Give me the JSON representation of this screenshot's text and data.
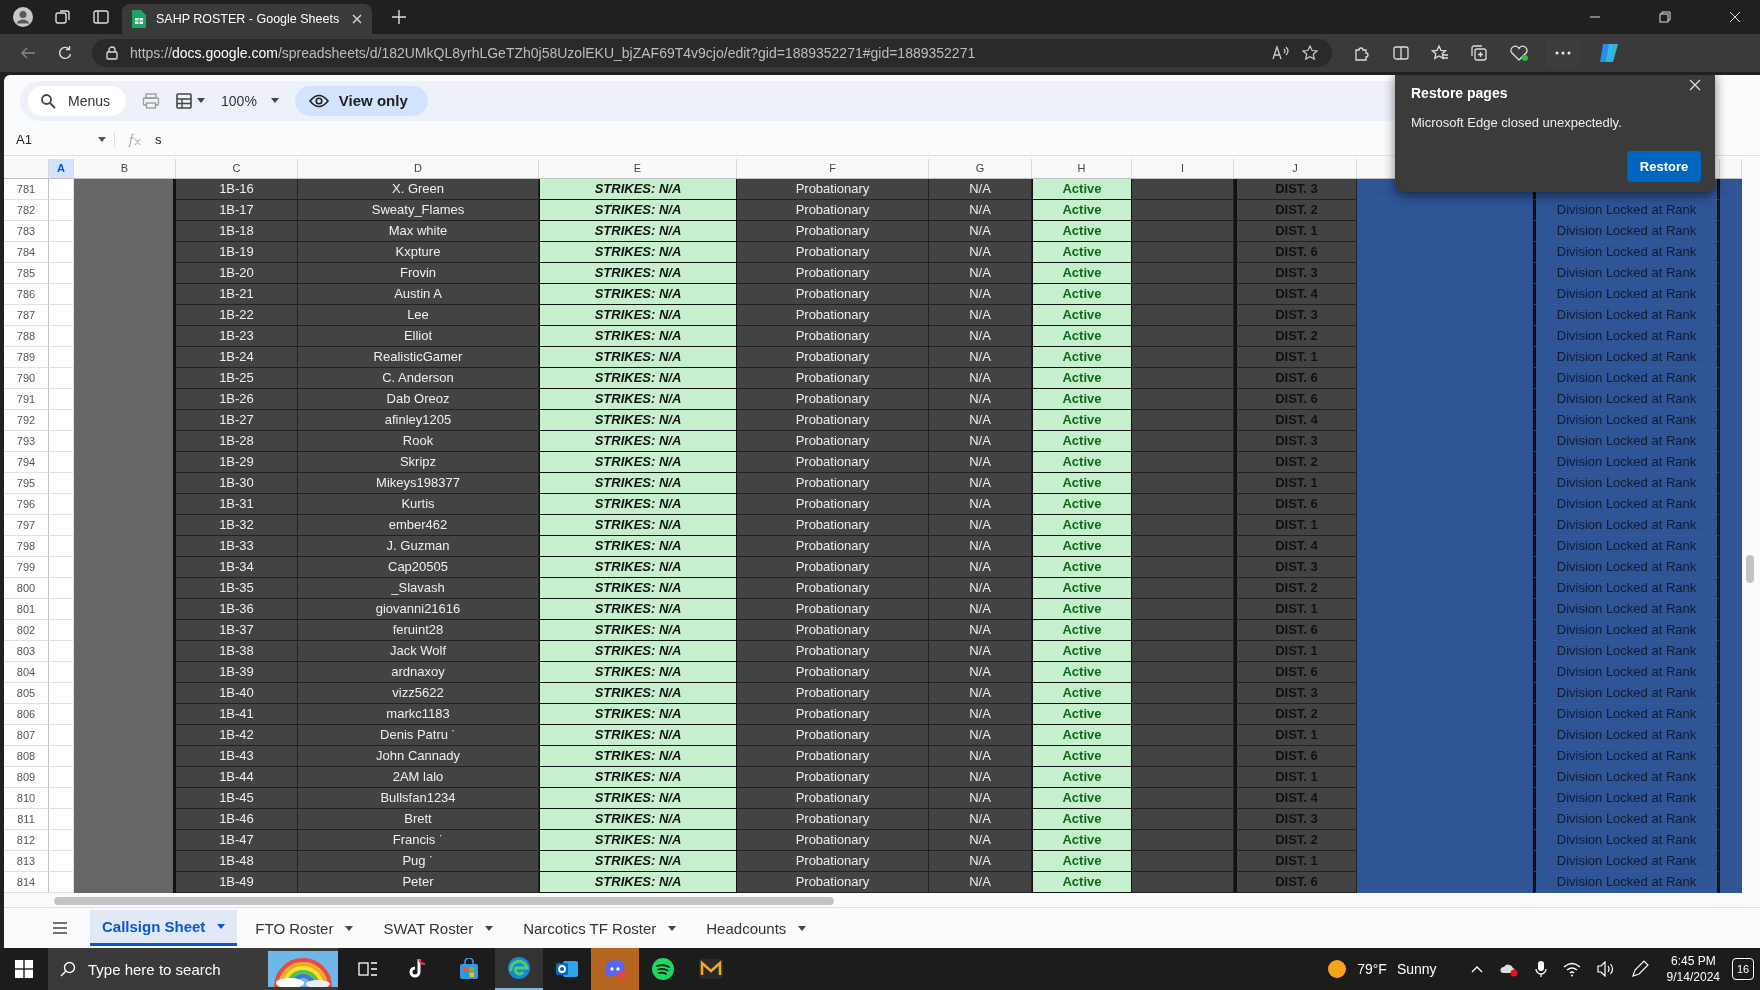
{
  "browser": {
    "tab_title": "SAHP ROSTER - Google Sheets",
    "url": "https://**docs.google.com**/spreadsheets/d/182UMkQL8yrhLGeTZh0j58UzolEKU_bjZAF69T4v9cjo/edit?gid=1889352271#gid=1889352271"
  },
  "toolbar": {
    "search_label": "Menus",
    "zoom": "100%",
    "mode": "View only"
  },
  "formula_bar": {
    "name_box": "A1",
    "formula": "s"
  },
  "columns": [
    {
      "label": "A",
      "selected": true
    },
    {
      "label": "B",
      "selected": false
    },
    {
      "label": "C",
      "selected": false
    },
    {
      "label": "D",
      "selected": false
    },
    {
      "label": "E",
      "selected": false
    },
    {
      "label": "F",
      "selected": false
    },
    {
      "label": "G",
      "selected": false
    },
    {
      "label": "H",
      "selected": false
    },
    {
      "label": "I",
      "selected": false
    },
    {
      "label": "J",
      "selected": false
    }
  ],
  "rows": [
    {
      "number": "781",
      "callsign": "1B-16",
      "name": "X. Green",
      "strikes": "STRIKES: N/A",
      "rank": "Probationary",
      "column_g": "N/A",
      "status": "Active",
      "district": "DIST. 3"
    },
    {
      "number": "782",
      "callsign": "1B-17",
      "name": "Sweaty_Flames",
      "strikes": "STRIKES: N/A",
      "rank": "Probationary",
      "column_g": "N/A",
      "status": "Active",
      "district": "DIST. 2",
      "division": "Division Locked at Rank"
    },
    {
      "number": "783",
      "callsign": "1B-18",
      "name": "Max white",
      "strikes": "STRIKES: N/A",
      "rank": "Probationary",
      "column_g": "N/A",
      "status": "Active",
      "district": "DIST. 1",
      "division": "Division Locked at Rank"
    },
    {
      "number": "784",
      "callsign": "1B-19",
      "name": "Kxpture",
      "strikes": "STRIKES: N/A",
      "rank": "Probationary",
      "column_g": "N/A",
      "status": "Active",
      "district": "DIST. 6",
      "division": "Division Locked at Rank"
    },
    {
      "number": "785",
      "callsign": "1B-20",
      "name": "Frovin",
      "strikes": "STRIKES: N/A",
      "rank": "Probationary",
      "column_g": "N/A",
      "status": "Active",
      "district": "DIST. 3",
      "division": "Division Locked at Rank"
    },
    {
      "number": "786",
      "callsign": "1B-21",
      "name": "Austin A",
      "strikes": "STRIKES: N/A",
      "rank": "Probationary",
      "column_g": "N/A",
      "status": "Active",
      "district": "DIST. 4",
      "division": "Division Locked at Rank"
    },
    {
      "number": "787",
      "callsign": "1B-22",
      "name": "Lee",
      "strikes": "STRIKES: N/A",
      "rank": "Probationary",
      "column_g": "N/A",
      "status": "Active",
      "district": "DIST. 3",
      "division": "Division Locked at Rank"
    },
    {
      "number": "788",
      "callsign": "1B-23",
      "name": "Elliot",
      "strikes": "STRIKES: N/A",
      "rank": "Probationary",
      "column_g": "N/A",
      "status": "Active",
      "district": "DIST. 2",
      "division": "Division Locked at Rank"
    },
    {
      "number": "789",
      "callsign": "1B-24",
      "name": "RealisticGamer",
      "strikes": "STRIKES: N/A",
      "rank": "Probationary",
      "column_g": "N/A",
      "status": "Active",
      "district": "DIST. 1",
      "division": "Division Locked at Rank"
    },
    {
      "number": "790",
      "callsign": "1B-25",
      "name": "C. Anderson",
      "strikes": "STRIKES: N/A",
      "rank": "Probationary",
      "column_g": "N/A",
      "status": "Active",
      "district": "DIST. 6",
      "division": "Division Locked at Rank"
    },
    {
      "number": "791",
      "callsign": "1B-26",
      "name": "Dab Oreoz",
      "strikes": "STRIKES: N/A",
      "rank": "Probationary",
      "column_g": "N/A",
      "status": "Active",
      "district": "DIST. 6",
      "division": "Division Locked at Rank"
    },
    {
      "number": "792",
      "callsign": "1B-27",
      "name": "afinley1205",
      "strikes": "STRIKES: N/A",
      "rank": "Probationary",
      "column_g": "N/A",
      "status": "Active",
      "district": "DIST. 4",
      "division": "Division Locked at Rank"
    },
    {
      "number": "793",
      "callsign": "1B-28",
      "name": "Rook",
      "strikes": "STRIKES: N/A",
      "rank": "Probationary",
      "column_g": "N/A",
      "status": "Active",
      "district": "DIST. 3",
      "division": "Division Locked at Rank"
    },
    {
      "number": "794",
      "callsign": "1B-29",
      "name": "Skripz",
      "strikes": "STRIKES: N/A",
      "rank": "Probationary",
      "column_g": "N/A",
      "status": "Active",
      "district": "DIST. 2",
      "division": "Division Locked at Rank"
    },
    {
      "number": "795",
      "callsign": "1B-30",
      "name": "Mikeys198377",
      "strikes": "STRIKES: N/A",
      "rank": "Probationary",
      "column_g": "N/A",
      "status": "Active",
      "district": "DIST. 1",
      "division": "Division Locked at Rank"
    },
    {
      "number": "796",
      "callsign": "1B-31",
      "name": "Kurtis",
      "strikes": "STRIKES: N/A",
      "rank": "Probationary",
      "column_g": "N/A",
      "status": "Active",
      "district": "DIST. 6",
      "division": "Division Locked at Rank"
    },
    {
      "number": "797",
      "callsign": "1B-32",
      "name": "ember462",
      "strikes": "STRIKES: N/A",
      "rank": "Probationary",
      "column_g": "N/A",
      "status": "Active",
      "district": "DIST. 1",
      "division": "Division Locked at Rank"
    },
    {
      "number": "798",
      "callsign": "1B-33",
      "name": "J. Guzman",
      "strikes": "STRIKES: N/A",
      "rank": "Probationary",
      "column_g": "N/A",
      "status": "Active",
      "district": "DIST. 4",
      "division": "Division Locked at Rank"
    },
    {
      "number": "799",
      "callsign": "1B-34",
      "name": "Cap20505",
      "strikes": "STRIKES: N/A",
      "rank": "Probationary",
      "column_g": "N/A",
      "status": "Active",
      "district": "DIST. 3",
      "division": "Division Locked at Rank"
    },
    {
      "number": "800",
      "callsign": "1B-35",
      "name": "_Slavash",
      "strikes": "STRIKES: N/A",
      "rank": "Probationary",
      "column_g": "N/A",
      "status": "Active",
      "district": "DIST. 2",
      "division": "Division Locked at Rank"
    },
    {
      "number": "801",
      "callsign": "1B-36",
      "name": "giovanni21616",
      "strikes": "STRIKES: N/A",
      "rank": "Probationary",
      "column_g": "N/A",
      "status": "Active",
      "district": "DIST. 1",
      "division": "Division Locked at Rank"
    },
    {
      "number": "802",
      "callsign": "1B-37",
      "name": "feruint28",
      "strikes": "STRIKES: N/A",
      "rank": "Probationary",
      "column_g": "N/A",
      "status": "Active",
      "district": "DIST. 6",
      "division": "Division Locked at Rank"
    },
    {
      "number": "803",
      "callsign": "1B-38",
      "name": "Jack Wolf",
      "strikes": "STRIKES: N/A",
      "rank": "Probationary",
      "column_g": "N/A",
      "status": "Active",
      "district": "DIST. 1",
      "division": "Division Locked at Rank"
    },
    {
      "number": "804",
      "callsign": "1B-39",
      "name": "ardnaxoy",
      "strikes": "STRIKES: N/A",
      "rank": "Probationary",
      "column_g": "N/A",
      "status": "Active",
      "district": "DIST. 6",
      "division": "Division Locked at Rank"
    },
    {
      "number": "805",
      "callsign": "1B-40",
      "name": "vizz5622",
      "strikes": "STRIKES: N/A",
      "rank": "Probationary",
      "column_g": "N/A",
      "status": "Active",
      "district": "DIST. 3",
      "division": "Division Locked at Rank"
    },
    {
      "number": "806",
      "callsign": "1B-41",
      "name": "markc1183",
      "strikes": "STRIKES: N/A",
      "rank": "Probationary",
      "column_g": "N/A",
      "status": "Active",
      "district": "DIST. 2",
      "division": "Division Locked at Rank"
    },
    {
      "number": "807",
      "callsign": "1B-42",
      "name": "Denis Patru ˙",
      "strikes": "STRIKES: N/A",
      "rank": "Probationary",
      "column_g": "N/A",
      "status": "Active",
      "district": "DIST. 1",
      "division": "Division Locked at Rank"
    },
    {
      "number": "808",
      "callsign": "1B-43",
      "name": "John Cannady",
      "strikes": "STRIKES: N/A",
      "rank": "Probationary",
      "column_g": "N/A",
      "status": "Active",
      "district": "DIST. 6",
      "division": "Division Locked at Rank"
    },
    {
      "number": "809",
      "callsign": "1B-44",
      "name": "2AM lalo",
      "strikes": "STRIKES: N/A",
      "rank": "Probationary",
      "column_g": "N/A",
      "status": "Active",
      "district": "DIST. 1",
      "division": "Division Locked at Rank"
    },
    {
      "number": "810",
      "callsign": "1B-45",
      "name": "Bullsfan1234",
      "strikes": "STRIKES: N/A",
      "rank": "Probationary",
      "column_g": "N/A",
      "status": "Active",
      "district": "DIST. 4",
      "division": "Division Locked at Rank"
    },
    {
      "number": "811",
      "callsign": "1B-46",
      "name": "Brett",
      "strikes": "STRIKES: N/A",
      "rank": "Probationary",
      "column_g": "N/A",
      "status": "Active",
      "district": "DIST. 3",
      "division": "Division Locked at Rank"
    },
    {
      "number": "812",
      "callsign": "1B-47",
      "name": "Francis ˙",
      "strikes": "STRIKES: N/A",
      "rank": "Probationary",
      "column_g": "N/A",
      "status": "Active",
      "district": "DIST. 2",
      "division": "Division Locked at Rank"
    },
    {
      "number": "813",
      "callsign": "1B-48",
      "name": "Pug ˙",
      "strikes": "STRIKES: N/A",
      "rank": "Probationary",
      "column_g": "N/A",
      "status": "Active",
      "district": "DIST. 1",
      "division": "Division Locked at Rank"
    },
    {
      "number": "814",
      "callsign": "1B-49",
      "name": "Peter",
      "strikes": "STRIKES: N/A",
      "rank": "Probationary",
      "column_g": "N/A",
      "status": "Active",
      "district": "DIST. 6",
      "division": "Division Locked at Rank"
    }
  ],
  "sheet_tabs": [
    {
      "label": "Callsign Sheet",
      "selected": true
    },
    {
      "label": "FTO Roster",
      "selected": false
    },
    {
      "label": "SWAT Roster",
      "selected": false
    },
    {
      "label": "Narcotics TF Roster",
      "selected": false
    },
    {
      "label": "Headcounts",
      "selected": false
    }
  ],
  "notification": {
    "title": "Restore pages",
    "message": "Microsoft Edge closed unexpectedly.",
    "button": "Restore"
  },
  "taskbar": {
    "search_placeholder": "Type here to search",
    "temperature": "79°F",
    "condition": "Sunny",
    "time": "6:45 PM",
    "date": "9/14/2024",
    "notification_count": "16"
  }
}
